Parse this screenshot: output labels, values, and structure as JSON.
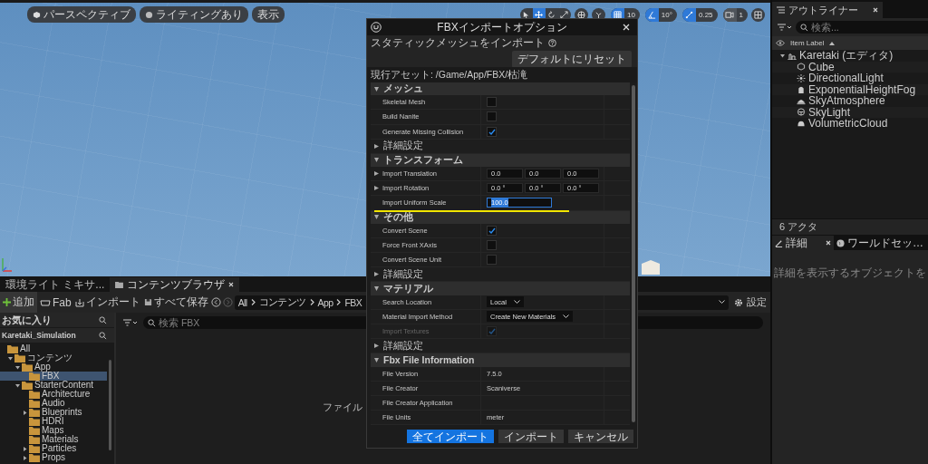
{
  "viewport": {
    "toolbar_left": [
      {
        "kind": "cube",
        "label": "パースペクティブ"
      },
      {
        "kind": "sphere",
        "label": "ライティングあり"
      },
      {
        "kind": "text",
        "label": "表示"
      }
    ],
    "transform_tools": [
      {
        "kind": "select",
        "selected": false
      },
      {
        "kind": "move",
        "selected": true
      },
      {
        "kind": "rotate",
        "selected": false
      },
      {
        "kind": "scale",
        "selected": false
      }
    ],
    "snaps": [
      {
        "kind": "grid",
        "value": "10",
        "on": true
      },
      {
        "kind": "angle",
        "value": "10°",
        "on": true
      },
      {
        "kind": "scale",
        "value": "0.25",
        "on": true
      },
      {
        "kind": "camera",
        "value": "1",
        "on": false
      }
    ]
  },
  "content_browser": {
    "tabs": [
      {
        "label": "環境ライト ミキサ...",
        "selected": false
      },
      {
        "label": "コンテンツブラウザ",
        "selected": true
      }
    ],
    "toolbar": [
      {
        "kind": "add",
        "label": "追加"
      },
      {
        "kind": "fab",
        "label": "Fab"
      },
      {
        "kind": "import",
        "label": "インポート"
      },
      {
        "kind": "save",
        "label": "すべて保存"
      }
    ],
    "path": [
      "All",
      "コンテンツ",
      "App",
      "FBX"
    ],
    "settings": "設定",
    "favorites": "お気に入り",
    "project": "Karetaki_Simulation",
    "tree": [
      {
        "label": "All",
        "expandable": false,
        "selected": false,
        "children": [
          {
            "label": "コンテンツ",
            "expandable": true,
            "expanded": true,
            "selected": false,
            "children": [
              {
                "label": "App",
                "expandable": true,
                "expanded": true,
                "selected": false,
                "children": [
                  {
                    "label": "FBX",
                    "expandable": false,
                    "selected": true
                  }
                ]
              },
              {
                "label": "StarterContent",
                "expandable": true,
                "expanded": true,
                "selected": false,
                "children": [
                  {
                    "label": "Architecture",
                    "expandable": false,
                    "selected": false
                  },
                  {
                    "label": "Audio",
                    "expandable": false,
                    "selected": false
                  },
                  {
                    "label": "Blueprints",
                    "expandable": true,
                    "expanded": false,
                    "selected": false
                  },
                  {
                    "label": "HDRI",
                    "expandable": false,
                    "selected": false
                  },
                  {
                    "label": "Maps",
                    "expandable": false,
                    "selected": false
                  },
                  {
                    "label": "Materials",
                    "expandable": false,
                    "selected": false
                  },
                  {
                    "label": "Particles",
                    "expandable": true,
                    "expanded": false,
                    "selected": false
                  },
                  {
                    "label": "Props",
                    "expandable": true,
                    "expanded": false,
                    "selected": false
                  }
                ]
              }
            ]
          }
        ]
      }
    ],
    "search": {
      "placeholder": "検索 FBX"
    },
    "empty_text": "ファイル"
  },
  "outliner": {
    "tab": "アウトライナー",
    "search": {
      "placeholder": "検索..."
    },
    "column": "Item Label",
    "tree": [
      {
        "label": "Karetaki (エディタ)",
        "kind": "level",
        "expandable": true,
        "expanded": true,
        "children": [
          {
            "label": "Cube",
            "kind": "cube",
            "expandable": false
          },
          {
            "label": "DirectionalLight",
            "kind": "sun",
            "expandable": false
          },
          {
            "label": "ExponentialHeightFog",
            "kind": "fog",
            "expandable": false
          },
          {
            "label": "SkyAtmosphere",
            "kind": "sky",
            "expandable": false
          },
          {
            "label": "SkyLight",
            "kind": "skylight",
            "expandable": false
          },
          {
            "label": "VolumetricCloud",
            "kind": "cloud",
            "expandable": false
          }
        ]
      }
    ],
    "actor_count": "6 アクタ"
  },
  "details": {
    "tabs": [
      {
        "label": "詳細",
        "kind": "pencil",
        "selected": true
      },
      {
        "label": "ワールドセッ…",
        "kind": "globe",
        "selected": false
      }
    ],
    "message": "詳細を表示するオブジェクトを"
  },
  "dialog": {
    "title": "FBXインポートオプション",
    "subtitle": "スタティックメッシュをインポート",
    "reset": "デフォルトにリセット",
    "asset_path": "現行アセット:  /Game/App/FBX/枯滝",
    "sections": [
      {
        "title": "メッシュ",
        "rows": [
          {
            "kind": "checkbox",
            "label": "Skeletal Mesh",
            "checked": false,
            "disabled": false
          },
          {
            "kind": "checkbox",
            "label": "Build Nanite",
            "checked": false,
            "disabled": false
          },
          {
            "kind": "checkbox",
            "label": "Generate Missing Collision",
            "checked": true,
            "disabled": false
          },
          {
            "kind": "advanced",
            "label": "詳細設定"
          }
        ]
      },
      {
        "title": "トランスフォーム",
        "rows": [
          {
            "kind": "vector",
            "label": "Import Translation",
            "values": [
              "0.0",
              "0.0",
              "0.0"
            ]
          },
          {
            "kind": "vector",
            "label": "Import Rotation",
            "values": [
              "0.0 °",
              "0.0 °",
              "0.0 °"
            ]
          },
          {
            "kind": "number",
            "label": "Import Uniform Scale",
            "value": "100.0",
            "text_selected": true
          }
        ]
      },
      {
        "title": "その他",
        "rows": [
          {
            "kind": "checkbox",
            "label": "Convert Scene",
            "checked": true,
            "disabled": false
          },
          {
            "kind": "checkbox",
            "label": "Force Front XAxis",
            "checked": false,
            "disabled": false
          },
          {
            "kind": "checkbox",
            "label": "Convert Scene Unit",
            "checked": false,
            "disabled": false
          },
          {
            "kind": "advanced",
            "label": "詳細設定"
          }
        ]
      },
      {
        "title": "マテリアル",
        "rows": [
          {
            "kind": "dropdown",
            "label": "Search Location",
            "value": "Local"
          },
          {
            "kind": "dropdown",
            "label": "Material Import Method",
            "value": "Create New Materials"
          },
          {
            "kind": "checkbox",
            "label": "Import Textures",
            "checked": true,
            "disabled": true
          },
          {
            "kind": "advanced",
            "label": "詳細設定"
          }
        ]
      },
      {
        "title": "Fbx File Information",
        "rows": [
          {
            "kind": "info",
            "label": "File Version",
            "value": "7.5.0"
          },
          {
            "kind": "info",
            "label": "File Creator",
            "value": "Scaniverse"
          },
          {
            "kind": "info",
            "label": "File Creator Application"
          },
          {
            "kind": "info",
            "label": "File Units",
            "value": "meter"
          }
        ]
      }
    ],
    "buttons": [
      {
        "label": "全てインポート",
        "primary": true
      },
      {
        "label": "インポート",
        "primary": false
      },
      {
        "label": "キャンセル",
        "primary": false
      }
    ]
  }
}
